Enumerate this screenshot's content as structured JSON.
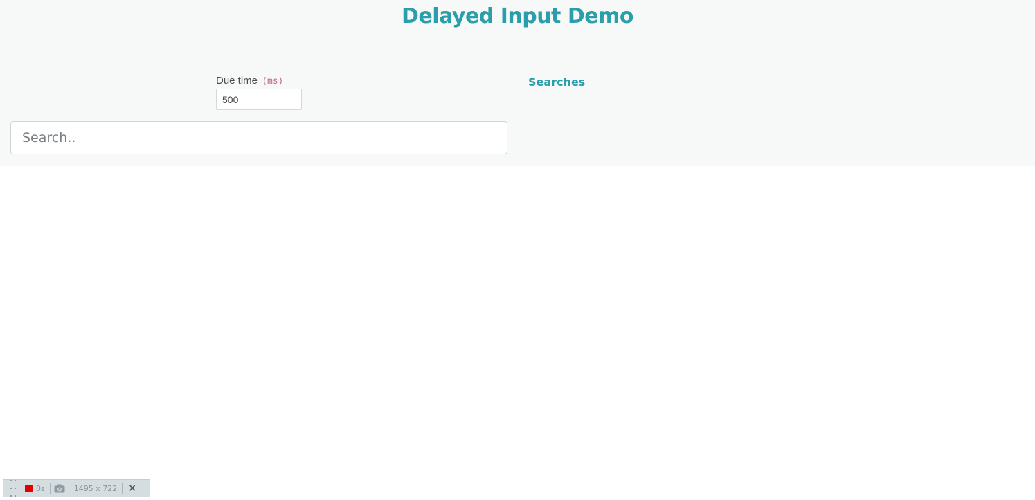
{
  "page": {
    "title": "Delayed Input Demo",
    "accent_color": "#2a9eaa"
  },
  "due_time": {
    "label": "Due time",
    "unit": "(ms)",
    "value": "500"
  },
  "search": {
    "placeholder": "Search..",
    "value": ""
  },
  "searches": {
    "heading": "Searches",
    "items": []
  },
  "recorder": {
    "grip_icon": "drag-handle-icon",
    "record_icon": "record-stop-icon",
    "timer": "0s",
    "camera_icon": "camera-icon",
    "dimensions": "1495 x 722",
    "close_label": "×",
    "record_color": "#e20000"
  }
}
